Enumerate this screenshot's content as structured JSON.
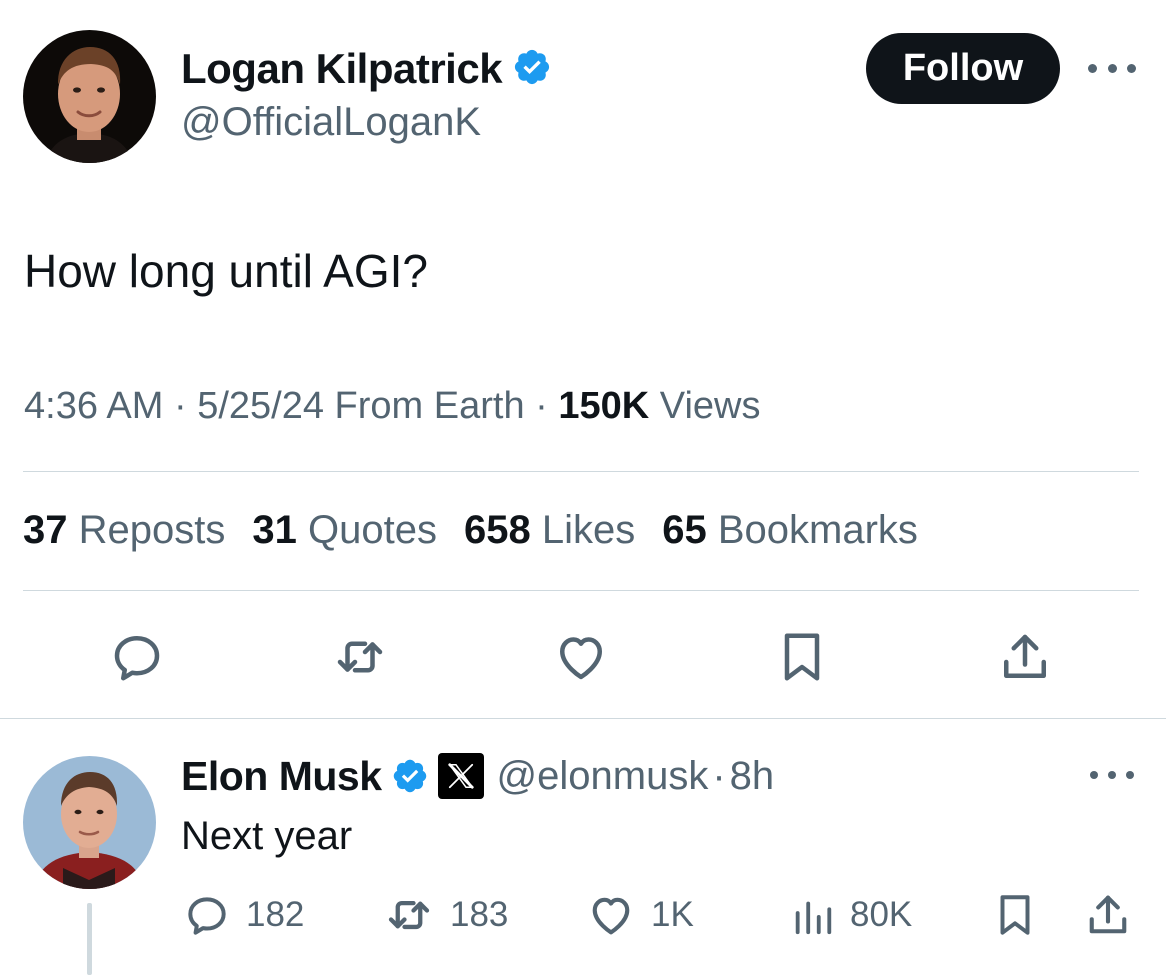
{
  "tweet": {
    "author": {
      "display_name": "Logan Kilpatrick",
      "handle": "@OfficialLoganK",
      "verified": true
    },
    "follow_label": "Follow",
    "text": "How long until AGI?",
    "meta": {
      "time": "4:36 AM",
      "separator": " · ",
      "date": "5/25/24",
      "source": " From Earth",
      "views_count": "150K",
      "views_label": " Views"
    },
    "stats": {
      "reposts_count": "37",
      "reposts_label": "Reposts",
      "quotes_count": "31",
      "quotes_label": "Quotes",
      "likes_count": "658",
      "likes_label": "Likes",
      "bookmarks_count": "65",
      "bookmarks_label": "Bookmarks"
    },
    "actions": [
      "reply-icon",
      "repost-icon",
      "like-icon",
      "bookmark-icon",
      "share-icon"
    ]
  },
  "reply": {
    "author": {
      "display_name": "Elon Musk",
      "verified": true,
      "affiliate_badge": "X",
      "handle": "@elonmusk",
      "separator": "·",
      "time_ago": "8h"
    },
    "text": "Next year",
    "actions": {
      "replies": "182",
      "reposts": "183",
      "likes": "1K",
      "views": "80K"
    }
  },
  "colors": {
    "text_primary": "#0f1419",
    "text_secondary": "#536471",
    "verified_blue": "#1d9bf0",
    "divider": "#cfd9de",
    "follow_bg": "#0f1419"
  }
}
